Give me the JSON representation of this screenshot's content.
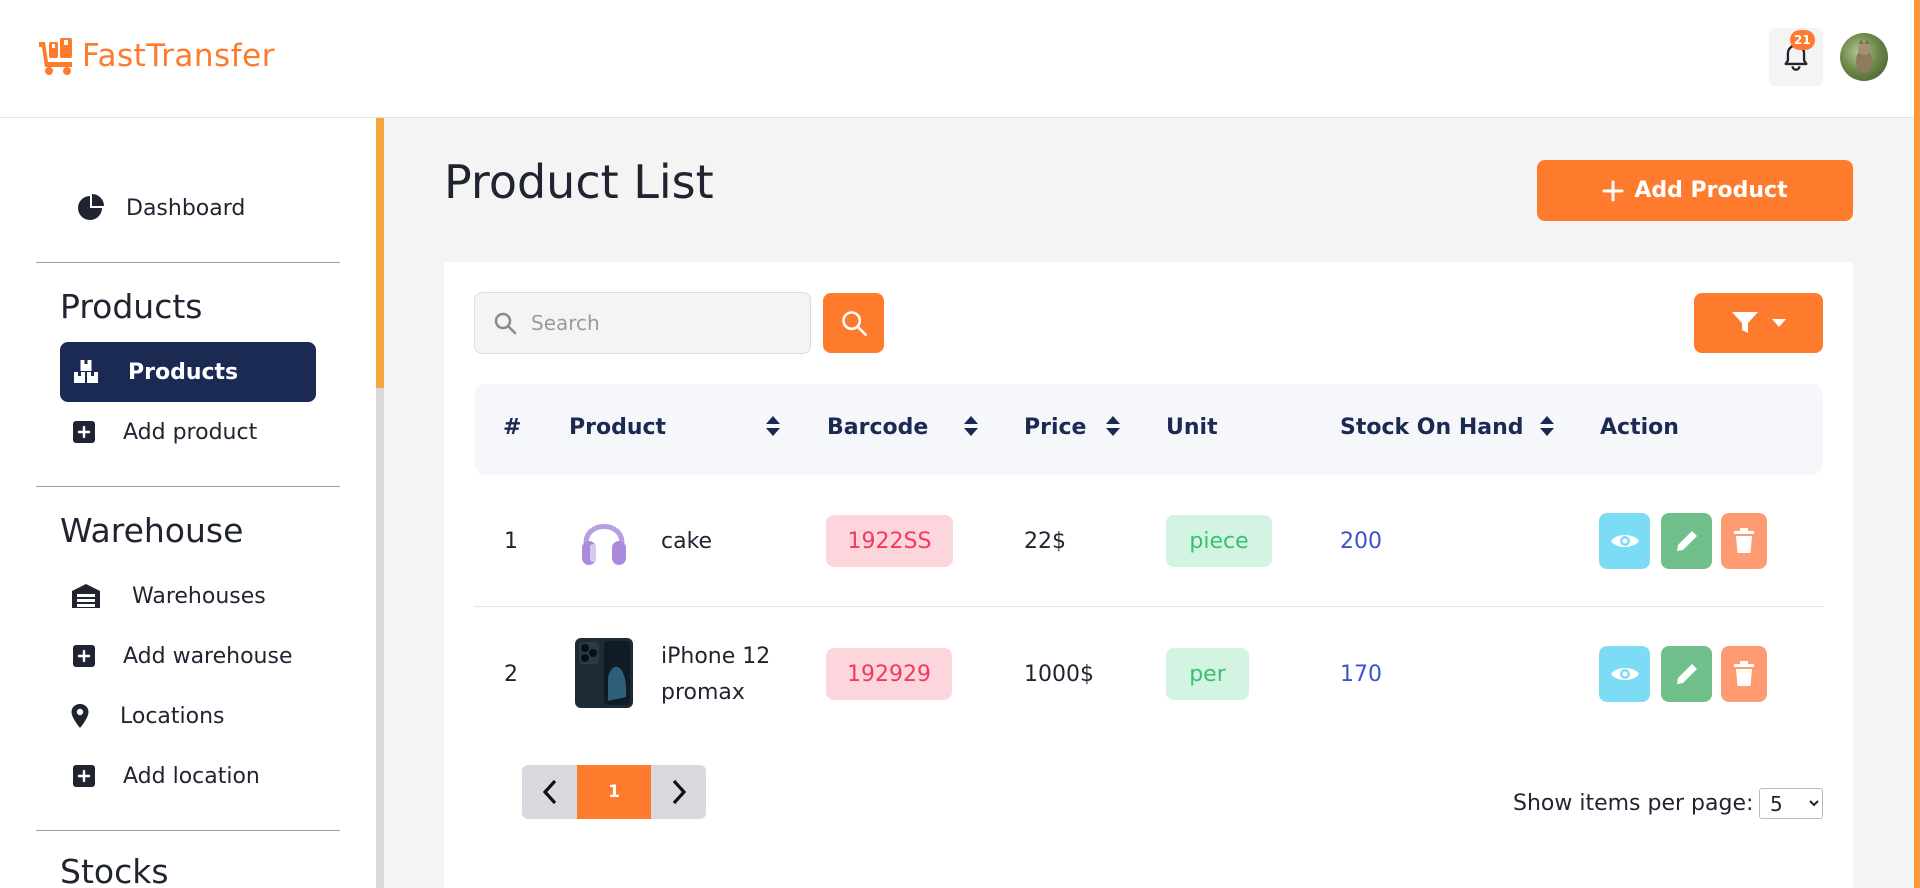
{
  "app": {
    "logo_text": "FastTransfer",
    "brand_color": "#fe7a2c",
    "notification_count": "21"
  },
  "sidebar": {
    "dashboard": "Dashboard",
    "sections": {
      "products": {
        "title": "Products",
        "items": [
          "Products",
          "Add product"
        ]
      },
      "warehouse": {
        "title": "Warehouse",
        "items": [
          "Warehouses",
          "Add warehouse",
          "Locations",
          "Add location"
        ]
      },
      "stocks": {
        "title": "Stocks"
      }
    },
    "active_item": "Products"
  },
  "main": {
    "title": "Product List",
    "add_button": "Add Product",
    "search": {
      "placeholder": "Search",
      "value": ""
    },
    "table": {
      "headers": [
        "#",
        "Product",
        "Barcode",
        "Price",
        "Unit",
        "Stock On Hand",
        "Action"
      ],
      "rows": [
        {
          "num": "1",
          "name": "cake",
          "name2": "",
          "image": "headphones-image",
          "barcode": "1922SS",
          "price": "22$",
          "unit": "piece",
          "stock": "200"
        },
        {
          "num": "2",
          "name": "iPhone 12",
          "name2": "promax",
          "image": "phone-image",
          "barcode": "192929",
          "price": "1000$",
          "unit": "per",
          "stock": "170"
        }
      ]
    },
    "pagination": {
      "current_page": "1"
    },
    "per_page": {
      "label": "Show items per page:",
      "value": "5",
      "options": [
        "5"
      ]
    }
  },
  "colors": {
    "accent": "#fe7a2c",
    "sidebar_active": "#1b2a52",
    "view": "#7ddcf5",
    "edit": "#71c08b",
    "delete": "#fe9b73"
  }
}
